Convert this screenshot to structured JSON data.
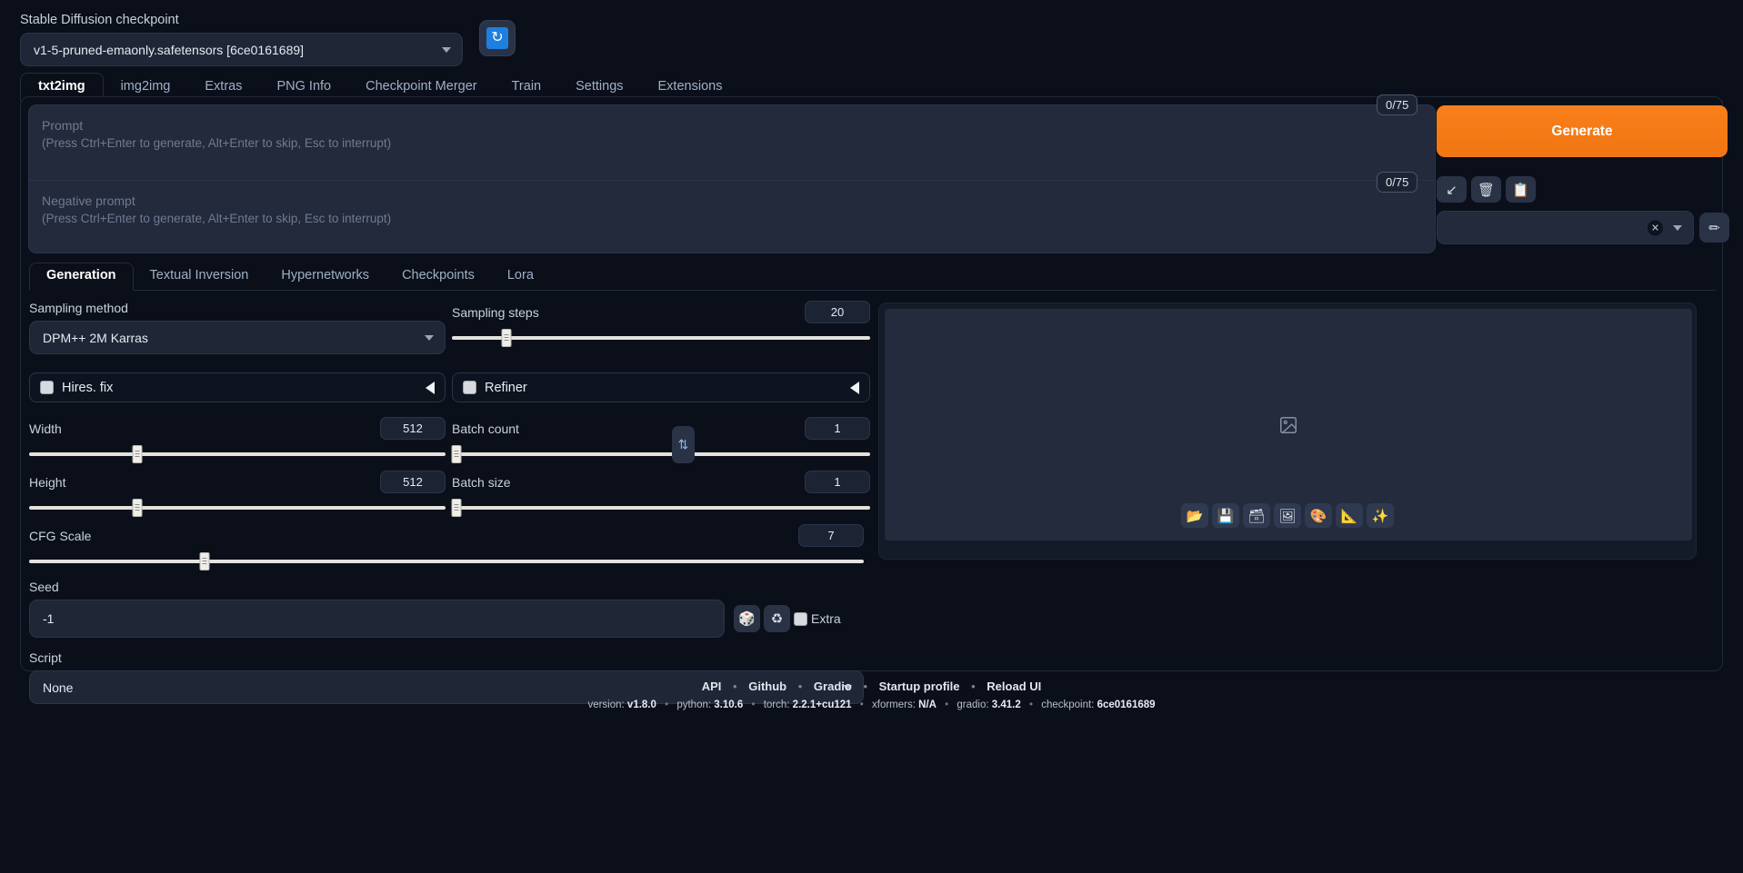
{
  "checkpoint": {
    "label": "Stable Diffusion checkpoint",
    "value": "v1-5-pruned-emaonly.safetensors [6ce0161689]",
    "refresh_icon": "refresh-icon"
  },
  "main_tabs": [
    {
      "label": "txt2img",
      "active": true
    },
    {
      "label": "img2img",
      "active": false
    },
    {
      "label": "Extras",
      "active": false
    },
    {
      "label": "PNG Info",
      "active": false
    },
    {
      "label": "Checkpoint Merger",
      "active": false
    },
    {
      "label": "Train",
      "active": false
    },
    {
      "label": "Settings",
      "active": false
    },
    {
      "label": "Extensions",
      "active": false
    }
  ],
  "prompt": {
    "title": "Prompt",
    "hint": "(Press Ctrl+Enter to generate, Alt+Enter to skip, Esc to interrupt)",
    "value": "",
    "token_counter": "0/75"
  },
  "negative_prompt": {
    "title": "Negative prompt",
    "hint": "(Press Ctrl+Enter to generate, Alt+Enter to skip, Esc to interrupt)",
    "value": "",
    "token_counter": "0/75"
  },
  "generate": {
    "label": "Generate",
    "color": "#f97f1c"
  },
  "mini_buttons": [
    {
      "name": "restore-progress-button",
      "glyph": "↙"
    },
    {
      "name": "clear-prompt-button",
      "glyph": "🗑"
    },
    {
      "name": "read-generation-parameters-button",
      "glyph": "📋"
    }
  ],
  "styles": {
    "value": "",
    "clear_glyph": "✕",
    "edit_glyph": "✏"
  },
  "sub_tabs": [
    {
      "label": "Generation",
      "active": true
    },
    {
      "label": "Textual Inversion",
      "active": false
    },
    {
      "label": "Hypernetworks",
      "active": false
    },
    {
      "label": "Checkpoints",
      "active": false
    },
    {
      "label": "Lora",
      "active": false
    }
  ],
  "sampling_method": {
    "label": "Sampling method",
    "value": "DPM++ 2M Karras"
  },
  "sampling_steps": {
    "label": "Sampling steps",
    "value": "20",
    "min": 1,
    "max": 150,
    "percent": 13
  },
  "hires_fix": {
    "label": "Hires. fix",
    "checked": false
  },
  "refiner": {
    "label": "Refiner",
    "checked": false
  },
  "width": {
    "label": "Width",
    "value": "512",
    "min": 64,
    "max": 2048,
    "percent": 26
  },
  "height": {
    "label": "Height",
    "value": "512",
    "min": 64,
    "max": 2048,
    "percent": 26
  },
  "batch_count": {
    "label": "Batch count",
    "value": "1",
    "min": 1,
    "max": 100,
    "percent": 1
  },
  "batch_size": {
    "label": "Batch size",
    "value": "1",
    "min": 1,
    "max": 8,
    "percent": 1
  },
  "cfg_scale": {
    "label": "CFG Scale",
    "value": "7",
    "min": 1,
    "max": 30,
    "percent": 21
  },
  "seed": {
    "label": "Seed",
    "value": "-1",
    "random_glyph": "🎲",
    "recycle_glyph": "♻",
    "extra_label": "Extra",
    "extra_checked": false
  },
  "script": {
    "label": "Script",
    "value": "None"
  },
  "preview": {
    "placeholder_icon": "image-placeholder-icon",
    "toolbar": [
      {
        "name": "open-folder-button",
        "glyph": "📂"
      },
      {
        "name": "save-button",
        "glyph": "💾"
      },
      {
        "name": "save-zip-button",
        "glyph": "🗃"
      },
      {
        "name": "send-to-img2img-button",
        "glyph": "🖼"
      },
      {
        "name": "send-to-inpaint-button",
        "glyph": "🎨"
      },
      {
        "name": "send-to-extras-button",
        "glyph": "📐"
      },
      {
        "name": "upscale-button",
        "glyph": "✨"
      }
    ]
  },
  "footer": {
    "links": [
      "API",
      "Github",
      "Gradio",
      "Startup profile",
      "Reload UI"
    ],
    "separator": "•",
    "version_items": [
      {
        "key": "version:",
        "value": "v1.8.0"
      },
      {
        "key": "python:",
        "value": "3.10.6"
      },
      {
        "key": "torch:",
        "value": "2.2.1+cu121"
      },
      {
        "key": "xformers:",
        "value": "N/A"
      },
      {
        "key": "gradio:",
        "value": "3.41.2"
      },
      {
        "key": "checkpoint:",
        "value": "6ce0161689"
      }
    ]
  }
}
